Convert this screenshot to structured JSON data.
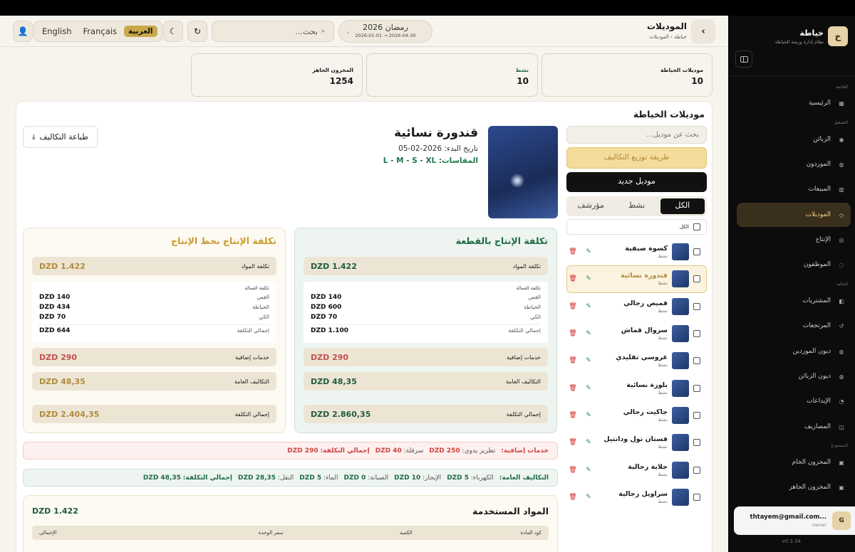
{
  "sidebar": {
    "brand_letter": "خ",
    "title": "خياطة",
    "subtitle": "نظام إدارة ورشة الخياطة",
    "sections": {
      "main": "القائمة",
      "ops": "التشغيل",
      "finance": "المالية",
      "stock": "المستودع"
    },
    "items": [
      {
        "label": "الرئيسية",
        "icon": "home-icon",
        "glyph": "▦"
      },
      {
        "label": "الزبائن",
        "icon": "customers-icon",
        "glyph": "◉"
      },
      {
        "label": "الموردون",
        "icon": "suppliers-icon",
        "glyph": "◍"
      },
      {
        "label": "المبيعات",
        "icon": "sales-icon",
        "glyph": "▥"
      },
      {
        "label": "الموديلات",
        "icon": "models-icon",
        "glyph": "◇"
      },
      {
        "label": "الإنتاج",
        "icon": "production-icon",
        "glyph": "◎"
      },
      {
        "label": "الموظفون",
        "icon": "employees-icon",
        "glyph": "◌"
      },
      {
        "label": "المشتريات",
        "icon": "purchases-icon",
        "glyph": "◧"
      },
      {
        "label": "المرتجعات",
        "icon": "returns-icon",
        "glyph": "↺"
      },
      {
        "label": "ديون الموردين",
        "icon": "supplier-debts-icon",
        "glyph": "◍"
      },
      {
        "label": "ديون الزبائن",
        "icon": "customer-debts-icon",
        "glyph": "◍"
      },
      {
        "label": "الإيداعات",
        "icon": "deposits-icon",
        "glyph": "◔"
      },
      {
        "label": "المصاريف",
        "icon": "expenses-icon",
        "glyph": "◫"
      },
      {
        "label": "المخزون الخام",
        "icon": "raw-stock-icon",
        "glyph": "▣"
      },
      {
        "label": "المخزون الجاهز",
        "icon": "ready-stock-icon",
        "glyph": "▣"
      }
    ],
    "user": {
      "avatar": "G",
      "email": "thtayem@gmail.com...",
      "role": "owner"
    },
    "version": "v0.3.34"
  },
  "header": {
    "title": "الموديلات",
    "breadcrumb": "خياطة › الموديلات",
    "back": "‹",
    "season_name": "رمضان 2026",
    "season_dates": "2026-01-01 → 2026-04-30",
    "search_placeholder": "بحث...",
    "languages": [
      "English",
      "Français",
      "العربية"
    ],
    "selected_language": "العربية"
  },
  "stats": [
    {
      "label": "موديلات الخياطة",
      "value": "10"
    },
    {
      "label": "نشط",
      "value": "10"
    },
    {
      "label": "المخزون الجاهز",
      "value": "1254"
    }
  ],
  "list": {
    "title": "موديلات الخياطة",
    "search_placeholder": "بحث عن موديل...",
    "distribution_button": "طريقة توزيع التكاليف",
    "new_button": "موديل جديد",
    "tabs": [
      "الكل",
      "نشط",
      "مؤرشف"
    ],
    "all_label": "الكل",
    "models": [
      {
        "name": "كسوة صيفية",
        "status": "نشط"
      },
      {
        "name": "قندورة نسائية",
        "status": "نشط"
      },
      {
        "name": "قميص رجالي",
        "status": "نشط"
      },
      {
        "name": "سروال قماش",
        "status": "نشط"
      },
      {
        "name": "عروسي تقليدي",
        "status": "نشط"
      },
      {
        "name": "بلوزة نسائية",
        "status": "نشط"
      },
      {
        "name": "جاكيت رجالي",
        "status": "نشط"
      },
      {
        "name": "فستان تول ودانتيل",
        "status": "نشط"
      },
      {
        "name": "جلابة رجالية",
        "status": "نشط"
      },
      {
        "name": "سراويل رجالية",
        "status": "نشط"
      }
    ]
  },
  "detail": {
    "name": "قندورة نسائية",
    "start_date": "تاريخ البدء: 2026-02-05",
    "sizes": "المقاسات: L - M - S - XL",
    "print_button": "طباعة التكاليف",
    "per_piece": {
      "title": "تكلفة الإنتاج بالقطعة",
      "materials_label": "تكلفة المواد",
      "materials": "DZD 1.422",
      "labor_header": "تكلفة العمالة",
      "labor": [
        {
          "label": "القص",
          "value": "DZD 140"
        },
        {
          "label": "الخياطة",
          "value": "DZD 600"
        },
        {
          "label": "الكي",
          "value": "DZD 70"
        }
      ],
      "labor_total_label": "إجمالي التكلفة",
      "labor_total": "DZD 1.100",
      "extra_label": "خدمات إضافية",
      "extra": "DZD 290",
      "overhead_label": "التكاليف العامة",
      "overhead": "DZD 48,35",
      "total_label": "إجمالي التكلفة",
      "total": "DZD 2.860,35"
    },
    "line": {
      "title": "تكلفة الإنتاج بخط الإنتاج",
      "materials_label": "تكلفة المواد",
      "materials": "DZD 1.422",
      "labor_header": "تكلفة العمالة",
      "labor": [
        {
          "label": "القص",
          "value": "DZD 140"
        },
        {
          "label": "الخياطة",
          "value": "DZD 434"
        },
        {
          "label": "الكي",
          "value": "DZD 70"
        }
      ],
      "labor_total_label": "إجمالي التكلفة",
      "labor_total": "DZD 644",
      "extra_label": "خدمات إضافية",
      "extra": "DZD 290",
      "overhead_label": "التكاليف العامة",
      "overhead": "DZD 48,35",
      "total_label": "إجمالي التكلفة",
      "total": "DZD 2.404,35"
    },
    "extras_band": {
      "title": "خدمات إضافية:",
      "items": [
        {
          "label": "تطريز يدوي:",
          "value": "DZD 250"
        },
        {
          "label": "سرفلة:",
          "value": "DZD 40"
        }
      ],
      "total_label": "إجمالي التكلفة:",
      "total": "DZD 290"
    },
    "overhead_band": {
      "title": "التكاليف العامة:",
      "items": [
        {
          "label": "الكهرباء:",
          "value": "DZD 5"
        },
        {
          "label": "الإيجار:",
          "value": "DZD 10"
        },
        {
          "label": "الصيانة:",
          "value": "DZD 0"
        },
        {
          "label": "الماء:",
          "value": "DZD 5"
        },
        {
          "label": "النقل:",
          "value": "DZD 28,35"
        }
      ],
      "total_label": "إجمالي التكلفة:",
      "total": "DZD 48,35"
    },
    "materials": {
      "title": "المواد المستخدمة",
      "total": "DZD 1.422",
      "columns": [
        "كود المادة",
        "الكمية",
        "سعر الوحدة",
        "الإجمالي"
      ]
    }
  }
}
